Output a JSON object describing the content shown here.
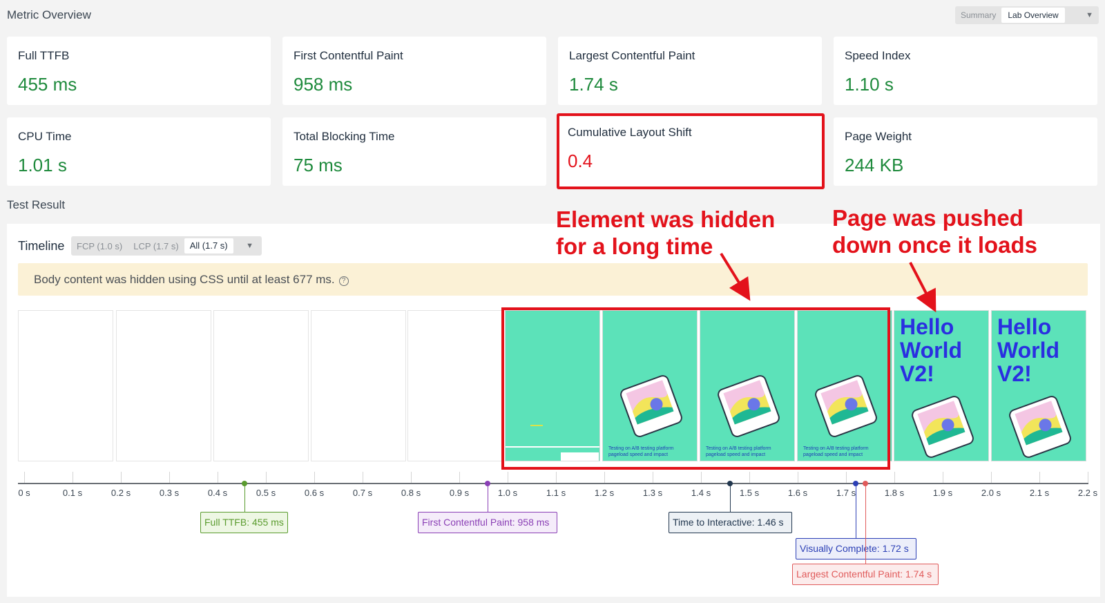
{
  "header": {
    "title": "Metric Overview",
    "toggle": {
      "summary_label": "Summary",
      "lab_label": "Lab Overview",
      "caret": "▼"
    }
  },
  "metrics": [
    {
      "label": "Full TTFB",
      "value": "455 ms"
    },
    {
      "label": "First Contentful Paint",
      "value": "958 ms"
    },
    {
      "label": "Largest Contentful Paint",
      "value": "1.74 s"
    },
    {
      "label": "Speed Index",
      "value": "1.10 s"
    },
    {
      "label": "CPU Time",
      "value": "1.01 s"
    },
    {
      "label": "Total Blocking Time",
      "value": "75 ms"
    },
    {
      "label": "Cumulative Layout Shift",
      "value": "0.4"
    },
    {
      "label": "Page Weight",
      "value": "244 KB"
    }
  ],
  "test_result": {
    "title": "Test Result",
    "timeline_label": "Timeline",
    "filter": {
      "fcp": "FCP (1.0 s)",
      "lcp": "LCP (1.7 s)",
      "all": "All (1.7 s)",
      "caret": "▼"
    },
    "notice": "Body content was hidden using CSS until at least 677 ms.",
    "help_icon": "?"
  },
  "filmstrip": {
    "caption_line1": "Testing on A/B testing platform",
    "caption_line2": "pageload speed and impact",
    "hello_text": [
      "Hello",
      "World",
      "V2!"
    ]
  },
  "annotations": {
    "hidden": [
      "Element was hidden",
      "for a long time"
    ],
    "pushed": [
      "Page was pushed",
      "down once it loads"
    ]
  },
  "axis": {
    "ticks": [
      "0 s",
      "0.1 s",
      "0.2 s",
      "0.3 s",
      "0.4 s",
      "0.5 s",
      "0.6 s",
      "0.7 s",
      "0.8 s",
      "0.9 s",
      "1.0 s",
      "1.1 s",
      "1.2 s",
      "1.3 s",
      "1.4 s",
      "1.5 s",
      "1.6 s",
      "1.7 s",
      "1.8 s",
      "1.9 s",
      "2.0 s",
      "2.1 s",
      "2.2 s"
    ]
  },
  "markers": [
    {
      "label": "Full TTFB: 455 ms",
      "time_s": 0.455,
      "color": "#5a9b2e",
      "bg": "#eef7e4"
    },
    {
      "label": "First Contentful Paint: 958 ms",
      "time_s": 0.958,
      "color": "#8a3fb5",
      "bg": "#f5ecfa"
    },
    {
      "label": "Time to Interactive: 1.46 s",
      "time_s": 1.46,
      "color": "#22374f",
      "bg": "#edf1f5"
    },
    {
      "label": "Visually Complete: 1.72 s",
      "time_s": 1.72,
      "color": "#2b3fb5",
      "bg": "#eceefa"
    },
    {
      "label": "Largest Contentful Paint: 1.74 s",
      "time_s": 1.74,
      "color": "#e05a5a",
      "bg": "#fcecec"
    }
  ],
  "colors": {
    "good": "#1e8a3c",
    "bad": "#e3121b",
    "frame_green": "#5ce2b9"
  }
}
